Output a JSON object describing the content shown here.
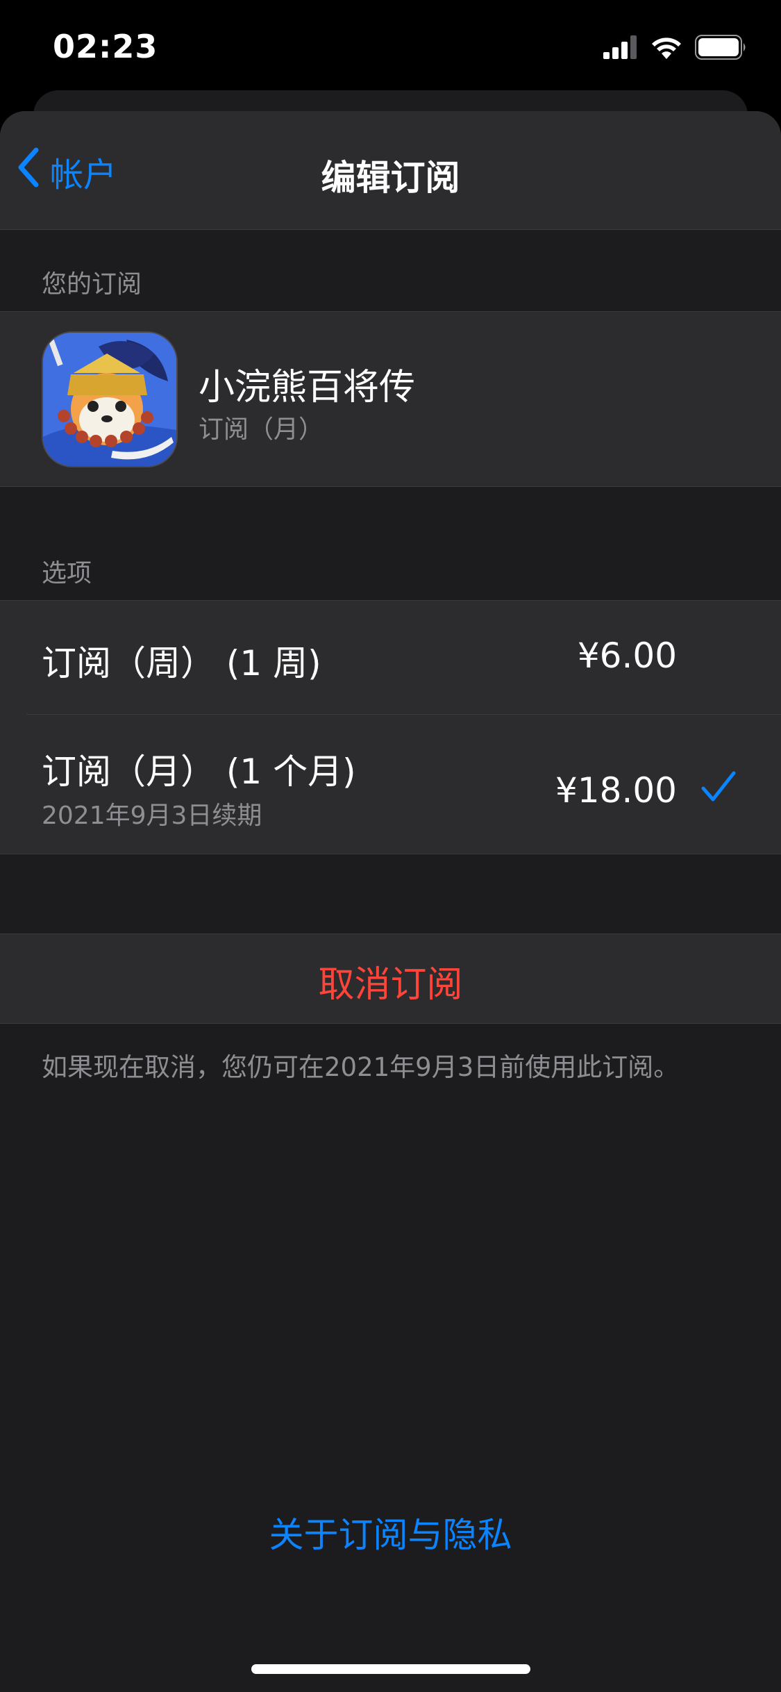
{
  "status_bar": {
    "time": "02:23",
    "icons": [
      "cellular-signal-icon",
      "wifi-icon",
      "battery-icon"
    ]
  },
  "nav": {
    "back_label": "帐户",
    "title": "编辑订阅"
  },
  "subscription": {
    "section_header": "您的订阅",
    "app_name": "小浣熊百将传",
    "plan": "订阅（月）",
    "icon": "raccoon-app-icon"
  },
  "options": {
    "section_header": "选项",
    "items": [
      {
        "label": "订阅（周） (1 周)",
        "price": "¥6.00",
        "selected": false
      },
      {
        "label": "订阅（月） (1 个月)",
        "sublabel": "2021年9月3日续期",
        "price": "¥18.00",
        "selected": true
      }
    ]
  },
  "cancel": {
    "label": "取消订阅",
    "footnote": "如果现在取消，您仍可在2021年9月3日前使用此订阅。"
  },
  "privacy_link": "关于订阅与隐私",
  "colors": {
    "accent": "#0a84ff",
    "destructive": "#ff453a",
    "background": "#1c1c1e",
    "cell": "#2c2c2e",
    "secondary_text": "#8e8e93"
  }
}
